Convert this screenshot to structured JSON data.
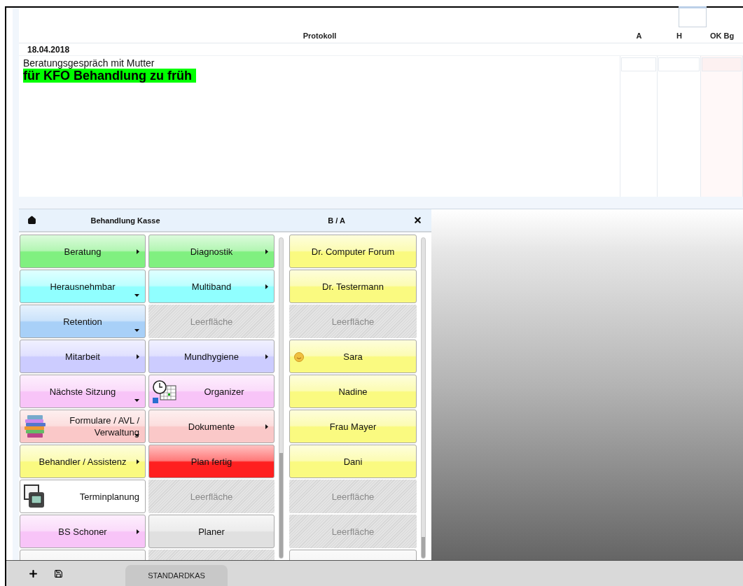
{
  "protocol": {
    "columns": [
      "Protokoll",
      "A",
      "H",
      "OK Bg"
    ],
    "date": "18.04.2018",
    "lines": [
      {
        "kind": "plain",
        "text": "Beratungsgespräch mit Mutter"
      },
      {
        "kind": "highlight",
        "text": "für KFO Behandlung zu früh",
        "color": "#00ff00"
      }
    ]
  },
  "panel": {
    "title": "Behandlung Kasse",
    "secondary_title": "B / A",
    "buttons": [
      {
        "kind": "button",
        "label": "Beratung",
        "color": "#80f080",
        "submenu": true,
        "dropdown": false
      },
      {
        "kind": "button",
        "label": "Diagnostik",
        "color": "#80f080",
        "submenu": true,
        "dropdown": false
      },
      {
        "kind": "button",
        "label": "Herausnehmbar",
        "color": "#90ffff",
        "submenu": false,
        "dropdown": true
      },
      {
        "kind": "button",
        "label": "Multiband",
        "color": "#90ffff",
        "submenu": true,
        "dropdown": false
      },
      {
        "kind": "button",
        "label": "Retention",
        "color": "#a8d0f8",
        "submenu": false,
        "dropdown": true
      },
      {
        "kind": "empty",
        "label": "Leerfläche"
      },
      {
        "kind": "button",
        "label": "Mitarbeit",
        "color": "#ccccff",
        "submenu": true,
        "dropdown": false
      },
      {
        "kind": "button",
        "label": "Mundhygiene",
        "color": "#ccccff",
        "submenu": true,
        "dropdown": false
      },
      {
        "kind": "button",
        "label": "Nächste Sitzung",
        "color": "#f8c4f8",
        "submenu": false,
        "dropdown": true
      },
      {
        "kind": "clock-button",
        "label": "Organizer",
        "color": "#f8c4f8",
        "submenu": false,
        "dropdown": false
      },
      {
        "kind": "books-button",
        "label": "Formulare / AVL / Verwaltung",
        "color": "#fac8c8",
        "submenu": false,
        "dropdown": true
      },
      {
        "kind": "button",
        "label": "Dokumente",
        "color": "#fac8c8",
        "submenu": true,
        "dropdown": false
      },
      {
        "kind": "button",
        "label": "Behandler / Assistenz",
        "color": "#fafa80",
        "submenu": true,
        "dropdown": false
      },
      {
        "kind": "button",
        "label": "Plan fertig",
        "color": "#ff2020",
        "submenu": false,
        "dropdown": false
      },
      {
        "kind": "monitor-button",
        "label": "Terminplanung",
        "color": "#ffffff",
        "submenu": false,
        "dropdown": false
      },
      {
        "kind": "empty",
        "label": "Leerfläche"
      },
      {
        "kind": "button",
        "label": "BS Schoner",
        "color": "#f8c4f8",
        "submenu": true,
        "dropdown": false
      },
      {
        "kind": "button",
        "label": "Planer",
        "color": "#e0e0e0",
        "submenu": false,
        "dropdown": false
      },
      {
        "kind": "blank",
        "color": "#eeeeee"
      },
      {
        "kind": "empty"
      }
    ],
    "staff": [
      {
        "kind": "button",
        "label": "Dr. Computer Forum",
        "color": "#fafa80"
      },
      {
        "kind": "button",
        "label": "Dr. Testermann",
        "color": "#fafa80"
      },
      {
        "kind": "empty",
        "label": "Leerfläche"
      },
      {
        "kind": "smiley-button",
        "label": "Sara",
        "color": "#fafa80"
      },
      {
        "kind": "button",
        "label": "Nadine",
        "color": "#fafa80"
      },
      {
        "kind": "button",
        "label": "Frau Mayer",
        "color": "#fafa80"
      },
      {
        "kind": "button",
        "label": "Dani",
        "color": "#fafa80"
      },
      {
        "kind": "empty",
        "label": "Leerfläche"
      },
      {
        "kind": "empty",
        "label": "Leerfläche"
      },
      {
        "kind": "blank",
        "color": "#eeeeee"
      }
    ]
  },
  "footer": {
    "tab": "STANDARDKAS"
  }
}
